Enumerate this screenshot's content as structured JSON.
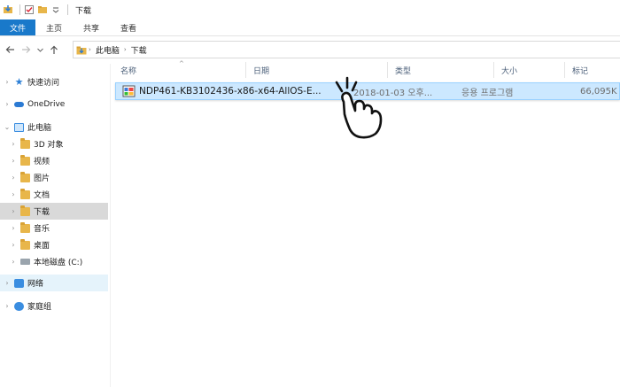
{
  "window": {
    "title": "下载"
  },
  "ribbon": {
    "tabs": [
      {
        "label": "文件"
      },
      {
        "label": "主页"
      },
      {
        "label": "共享"
      },
      {
        "label": "查看"
      }
    ]
  },
  "address": {
    "crumbs": [
      {
        "label": "此电脑"
      },
      {
        "label": "下载"
      }
    ]
  },
  "sidebar": {
    "items": [
      {
        "label": "快速访问",
        "icon": "star-icon"
      },
      {
        "label": "OneDrive",
        "icon": "cloud-icon"
      },
      {
        "label": "此电脑",
        "icon": "pc-icon"
      },
      {
        "label": "3D 对象",
        "icon": "folder-icon"
      },
      {
        "label": "视频",
        "icon": "folder-icon"
      },
      {
        "label": "图片",
        "icon": "folder-icon"
      },
      {
        "label": "文档",
        "icon": "folder-icon"
      },
      {
        "label": "下载",
        "icon": "folder-icon"
      },
      {
        "label": "音乐",
        "icon": "folder-icon"
      },
      {
        "label": "桌面",
        "icon": "folder-icon"
      },
      {
        "label": "本地磁盘 (C:)",
        "icon": "drive-icon"
      },
      {
        "label": "网络",
        "icon": "net-icon"
      },
      {
        "label": "家庭组",
        "icon": "home-icon"
      }
    ]
  },
  "columns": {
    "name": "名称",
    "date": "日期",
    "type": "类型",
    "size": "大小",
    "tags": "标记"
  },
  "files": [
    {
      "name": "NDP461-KB3102436-x86-x64-AllOS-E...",
      "date": "2018-01-03 오후...",
      "type": "응용 프로그램",
      "size": "66,095K",
      "icon": "installer-exe-icon"
    }
  ],
  "colors": {
    "accent": "#1979ca",
    "selection": "#cce8ff",
    "selection_border": "#99d1ff",
    "nav_selected": "#d9d9d9",
    "nav_hover": "#e5f3fb"
  }
}
